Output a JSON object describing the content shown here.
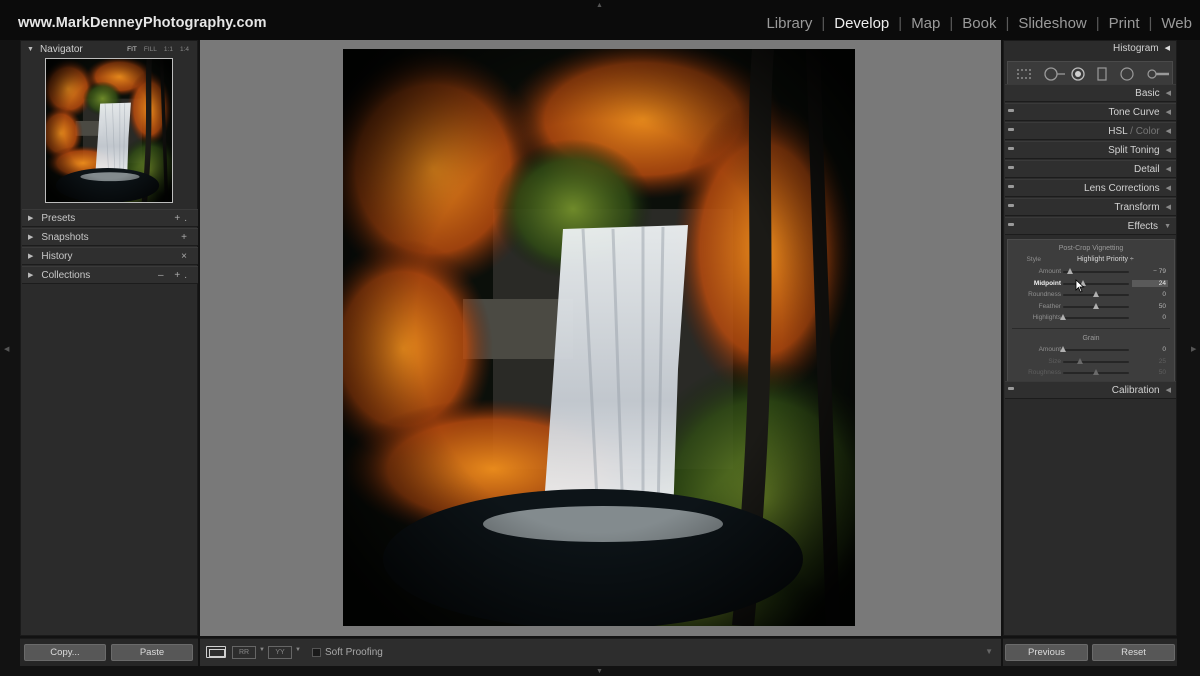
{
  "header": {
    "brand": "www.MarkDenneyPhotography.com",
    "modules": [
      "Library",
      "Develop",
      "Map",
      "Book",
      "Slideshow",
      "Print",
      "Web"
    ],
    "active_module": "Develop"
  },
  "left_panel": {
    "navigator": {
      "title": "Navigator",
      "zoom": [
        "FIT",
        "FILL",
        "1:1",
        "1:4"
      ]
    },
    "sections": [
      {
        "label": "Presets",
        "ctl": "+."
      },
      {
        "label": "Snapshots",
        "ctl": "+"
      },
      {
        "label": "History",
        "ctl": "×"
      },
      {
        "label": "Collections",
        "ctl": "– +."
      }
    ],
    "copy_label": "Copy...",
    "paste_label": "Paste"
  },
  "right_panel": {
    "histogram_title": "Histogram",
    "sections": [
      {
        "label": "Basic"
      },
      {
        "label": "Tone Curve"
      },
      {
        "label": "HSL",
        "label_dim": " / Color"
      },
      {
        "label": "Split Toning"
      },
      {
        "label": "Detail"
      },
      {
        "label": "Lens Corrections"
      },
      {
        "label": "Transform"
      },
      {
        "label": "Effects"
      },
      {
        "label": "Calibration"
      }
    ],
    "effects": {
      "vignette_title": "Post-Crop Vignetting",
      "style_label": "Style",
      "style_value": "Highlight Priority ÷",
      "vignette_sliders": [
        {
          "label": "Amount",
          "value": "− 79",
          "level": 0.1
        },
        {
          "label": "Midpoint",
          "value": "24",
          "level": 0.3
        },
        {
          "label": "Roundness",
          "value": "0",
          "level": 0.5
        },
        {
          "label": "Feather",
          "value": "50",
          "level": 0.5
        },
        {
          "label": "Highlights",
          "value": "0",
          "level": 0.0
        }
      ],
      "grain_title": "Grain",
      "grain_sliders": [
        {
          "label": "Amount",
          "value": "0",
          "level": 0.0
        },
        {
          "label": "Size",
          "value": "25",
          "level": 0.25
        },
        {
          "label": "Roughness",
          "value": "50",
          "level": 0.5
        }
      ]
    },
    "previous_label": "Previous",
    "reset_label": "Reset"
  },
  "toolbar": {
    "soft_proofing_label": "Soft Proofing",
    "compare_label": "RR",
    "survey_label": "YY"
  },
  "colors": {
    "bg": "#121212",
    "panel": "#2b2b2b",
    "canvas": "#797979",
    "accent_text": "#eeeeee"
  }
}
